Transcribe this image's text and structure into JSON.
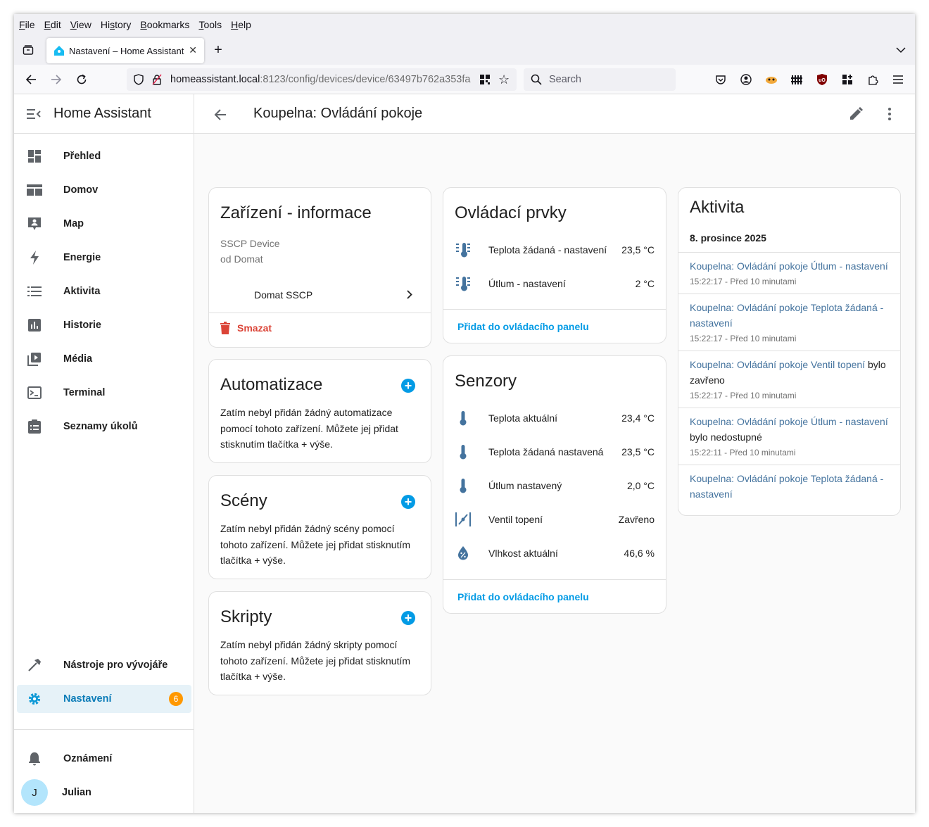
{
  "browser": {
    "menu": [
      "File",
      "Edit",
      "View",
      "History",
      "Bookmarks",
      "Tools",
      "Help"
    ],
    "tab_title": "Nastavení – Home Assistant",
    "url_host": "homeassistant.local",
    "url_path": ":8123/config/devices/device/63497b762a353fa",
    "search_placeholder": "Search"
  },
  "sidebar": {
    "brand": "Home Assistant",
    "items": [
      {
        "label": "Přehled",
        "icon": "dashboard-icon"
      },
      {
        "label": "Domov",
        "icon": "view-dashboard-icon"
      },
      {
        "label": "Map",
        "icon": "map-account-icon"
      },
      {
        "label": "Energie",
        "icon": "lightning-icon"
      },
      {
        "label": "Aktivita",
        "icon": "list-icon"
      },
      {
        "label": "Historie",
        "icon": "chart-box-icon"
      },
      {
        "label": "Média",
        "icon": "play-box-icon"
      },
      {
        "label": "Terminal",
        "icon": "console-icon"
      },
      {
        "label": "Seznamy úkolů",
        "icon": "clipboard-list-icon"
      }
    ],
    "dev_tools": "Nástroje pro vývojáře",
    "settings": "Nastavení",
    "settings_badge": "6",
    "notifications": "Oznámení",
    "user": "Julian",
    "user_initial": "J"
  },
  "header": {
    "title": "Koupelna: Ovládání pokoje"
  },
  "device_info": {
    "title": "Zařízení - informace",
    "model": "SSCP Device",
    "manufacturer": "od Domat",
    "integration": "Domat SSCP",
    "delete": "Smazat"
  },
  "automations": {
    "title": "Automatizace",
    "text": "Zatím nebyl přidán žádný automatizace pomocí tohoto zařízení. Můžete jej přidat stisknutím tlačítka + výše."
  },
  "scenes": {
    "title": "Scény",
    "text": "Zatím nebyl přidán žádný scény pomocí tohoto zařízení. Můžete jej přidat stisknutím tlačítka + výše."
  },
  "scripts": {
    "title": "Skripty",
    "text": "Zatím nebyl přidán žádný skripty pomocí tohoto zařízení. Můžete jej přidat stisknutím tlačítka + výše."
  },
  "controls": {
    "title": "Ovládací prvky",
    "rows": [
      {
        "name": "Teplota žádaná - nastavení",
        "value": "23,5 °C"
      },
      {
        "name": "Útlum - nastavení",
        "value": "2 °C"
      }
    ],
    "action": "Přidat do ovládacího panelu"
  },
  "sensors": {
    "title": "Senzory",
    "rows": [
      {
        "name": "Teplota aktuální",
        "value": "23,4 °C"
      },
      {
        "name": "Teplota žádaná nastavená",
        "value": "23,5 °C"
      },
      {
        "name": "Útlum nastavený",
        "value": "2,0 °C"
      },
      {
        "name": "Ventil topení",
        "value": "Zavřeno"
      },
      {
        "name": "Vlhkost aktuální",
        "value": "46,6 %"
      }
    ],
    "action": "Přidat do ovládacího panelu"
  },
  "activity": {
    "title": "Aktivita",
    "date": "8. prosince 2025",
    "items": [
      {
        "link": "Koupelna: Ovládání pokoje Útlum - nastavení",
        "text": "",
        "time": "15:22:17 - Před 10 minutami"
      },
      {
        "link": "Koupelna: Ovládání pokoje Teplota žádaná - nastavení",
        "text": "",
        "time": "15:22:17 - Před 10 minutami"
      },
      {
        "link": "Koupelna: Ovládání pokoje Ventil topení",
        "text": " bylo zavřeno",
        "time": "15:22:17 - Před 10 minutami"
      },
      {
        "link": "Koupelna: Ovládání pokoje Útlum - nastavení",
        "text": " bylo nedostupné",
        "time": "15:22:11 - Před 10 minutami"
      },
      {
        "link": "Koupelna: Ovládání pokoje Teplota žádaná - nastavení",
        "text": "",
        "time": ""
      }
    ]
  },
  "colors": {
    "accent": "#039be5",
    "entity_icon": "#44739e",
    "delete": "#db4437",
    "badge": "#ff9800"
  }
}
